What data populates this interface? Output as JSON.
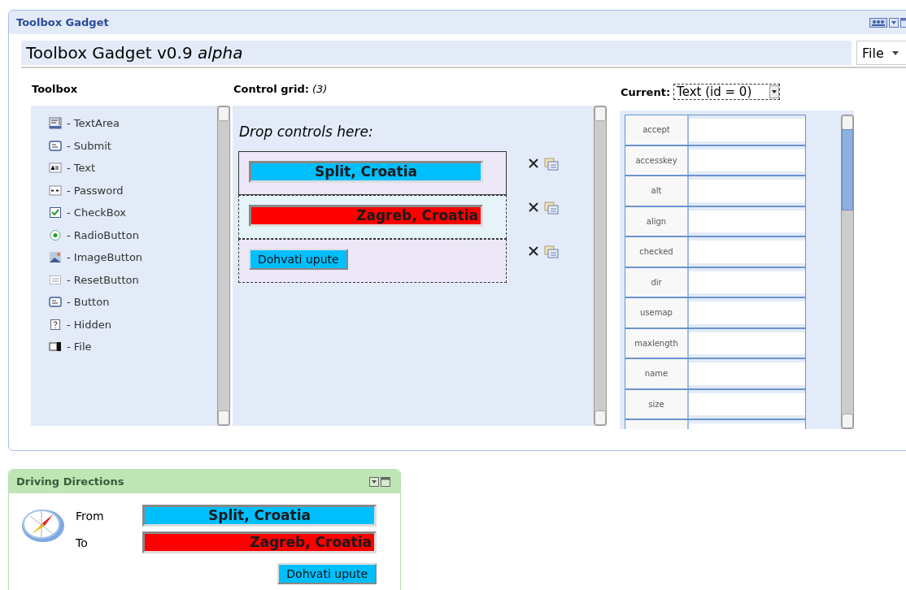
{
  "toolbox_gadget": {
    "header_title": "Toolbox Gadget",
    "title": "Toolbox Gadget v0.9 *alpha*",
    "menu": "File",
    "toolbox": {
      "heading": "Toolbox",
      "items": [
        {
          "kind": "textarea",
          "label": "- TextArea"
        },
        {
          "kind": "submit",
          "label": "- Submit"
        },
        {
          "kind": "text",
          "label": "- Text"
        },
        {
          "kind": "password",
          "label": "- Password"
        },
        {
          "kind": "checkbox",
          "label": "- CheckBox"
        },
        {
          "kind": "radio",
          "label": "- RadioButton"
        },
        {
          "kind": "image",
          "label": "- ImageButton"
        },
        {
          "kind": "reset",
          "label": "- ResetButton"
        },
        {
          "kind": "button",
          "label": "- Button"
        },
        {
          "kind": "hidden",
          "label": "- Hidden"
        },
        {
          "kind": "file",
          "label": "- File"
        }
      ]
    },
    "control_grid": {
      "heading": "Control grid:",
      "count": "(3)",
      "hint": "Drop controls here:",
      "controls": [
        {
          "kind": "field",
          "value": "Split, Croatia",
          "color": "#00bfff",
          "selected": true
        },
        {
          "kind": "field",
          "value": "Zagreb, Croatia",
          "color": "#ff0000",
          "selected": false
        },
        {
          "kind": "button",
          "value": "Dohvati upute",
          "color": "#00bfff",
          "selected": false
        }
      ]
    },
    "current": {
      "label": "Current:",
      "value": "Text (id = 0)",
      "properties": [
        {
          "name": "accept"
        },
        {
          "name": "accesskey"
        },
        {
          "name": "alt"
        },
        {
          "name": "align"
        },
        {
          "name": "checked"
        },
        {
          "name": "dir"
        },
        {
          "name": "usemap"
        },
        {
          "name": "maxlength"
        },
        {
          "name": "name"
        },
        {
          "name": "size"
        }
      ]
    }
  },
  "driving_directions": {
    "title": "Driving Directions",
    "fields": [
      {
        "label": "From",
        "value": "Split, Croatia",
        "color": "#00bfff"
      },
      {
        "label": "To",
        "value": "Zagreb, Croatia",
        "color": "#ff0000"
      }
    ],
    "button": "Dohvati upute"
  }
}
